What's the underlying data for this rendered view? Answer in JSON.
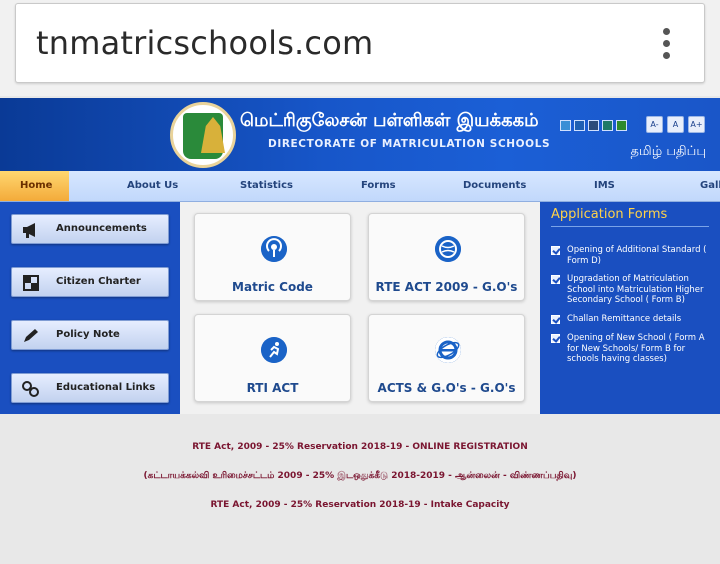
{
  "browser": {
    "url": "tnmatricschools.com",
    "menu_icon": "more-vert-icon"
  },
  "header": {
    "title_tamil": "மெட்ரிகுலேசன் பள்ளிகள் இயக்ககம்",
    "title_english": "DIRECTORATE OF MATRICULATION SCHOOLS",
    "theme_colors": [
      "#3a8fd6",
      "#1f5fb3",
      "#2c4b7a",
      "#1f7a66",
      "#2e8a2e"
    ],
    "font_buttons": [
      "A-",
      "A",
      "A+"
    ],
    "language_link": "தமிழ் பதிப்பு"
  },
  "nav": {
    "items": [
      "Home",
      "About Us",
      "Statistics",
      "Forms",
      "Documents",
      "IMS",
      "Gall"
    ]
  },
  "sidebar": {
    "items": [
      {
        "label": "Announcements",
        "icon": "megaphone-icon"
      },
      {
        "label": "Citizen Charter",
        "icon": "chart-icon"
      },
      {
        "label": "Policy Note",
        "icon": "pencil-icon"
      },
      {
        "label": "Educational Links",
        "icon": "link-icon"
      }
    ]
  },
  "tiles": [
    {
      "label": "Matric Code",
      "icon": "podcast-icon"
    },
    {
      "label": "RTE ACT 2009 - G.O's",
      "icon": "globe-icon"
    },
    {
      "label": "RTI ACT",
      "icon": "runner-icon"
    },
    {
      "label": "ACTS & G.O's - G.O's",
      "icon": "ie-icon"
    }
  ],
  "application_forms": {
    "title": "Application Forms",
    "items": [
      "Opening of Additional Standard ( Form D)",
      "Upgradation of Matriculation School into Matriculation Higher Secondary School ( Form B)",
      "Challan Remittance details",
      "Opening of New School ( Form A for New Schools/ Form B for schools having classes)"
    ]
  },
  "links": [
    "RTE Act, 2009 - 25% Reservation 2018-19 - ONLINE REGISTRATION",
    "(கட்டாயக்கல்வி உரிமைச்சட்டம் 2009 - 25% இடஒதுக்கீடு 2018-2019 - ஆன்லைன் - விண்ணப்பதிவு)",
    "RTE Act, 2009 - 25% Reservation 2018-19 - Intake Capacity"
  ]
}
